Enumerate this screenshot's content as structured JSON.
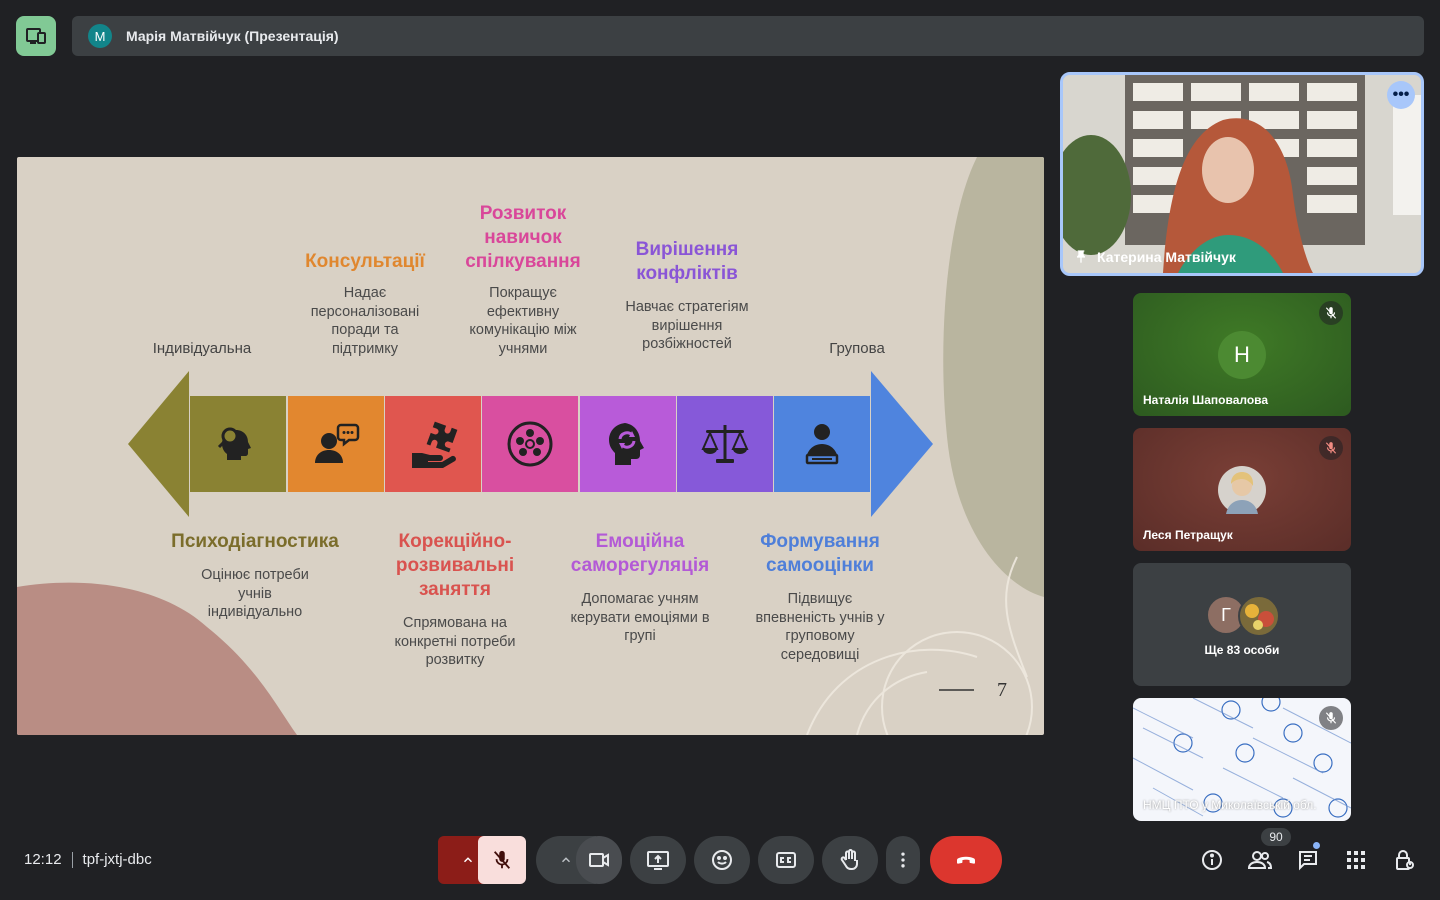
{
  "top_bar": {
    "presenter_initial": "M",
    "presenter_label": "Марія Матвійчук (Презентація)"
  },
  "slide": {
    "left_label": "Індивідуальна",
    "right_label": "Групова",
    "page_number": "7",
    "top_items": [
      {
        "title": "Консультації",
        "desc": "Надає персоналізовані поради та підтримку",
        "color": "#e0872f"
      },
      {
        "title": "Розвиток навичок спілкування",
        "desc": "Покращує ефективну комунікацію між учнями",
        "color": "#d9479a"
      },
      {
        "title": "Вирішення конфліктів",
        "desc": "Навчає стратегіям вирішення розбіжностей",
        "color": "#8a55d6"
      }
    ],
    "bottom_items": [
      {
        "title": "Психодіагностика",
        "desc": "Оцінює потреби учнів індивідуально",
        "color": "#7b6d2b"
      },
      {
        "title": "Корекційно-розвивальні заняття",
        "desc": "Спрямована на конкретні потреби розвитку",
        "color": "#d9534f"
      },
      {
        "title": "Емоційна саморегуляція",
        "desc": "Допомагає учням керувати емоціями в групі",
        "color": "#b35ad6"
      },
      {
        "title": "Формування самооцінки",
        "desc": "Підвищує впевненість учнів у груповому середовищі",
        "color": "#4f7fd9"
      }
    ],
    "segment_colors": [
      "#8a8233",
      "#e2872f",
      "#e0564f",
      "#d94fa0",
      "#b85bd9",
      "#8659d9",
      "#4f84de"
    ]
  },
  "participants": {
    "main": {
      "name": "Катерина Матвійчук"
    },
    "tiles": [
      {
        "name": "Наталія Шаповалова",
        "initial": "Н"
      },
      {
        "name": "Леся Петращук"
      },
      {
        "name": "Ще 83 особи",
        "initial": "Г"
      },
      {
        "name": "НМЦ ПТО у Миколаївській обл."
      }
    ]
  },
  "bottom_bar": {
    "time": "12:12",
    "meeting_code": "tpf-jxtj-dbc",
    "participant_count": "90"
  },
  "colors": {
    "end_call": "#ea4335",
    "mic_off_bg": "#f9dedc",
    "accent_border": "#a8c7fa"
  }
}
